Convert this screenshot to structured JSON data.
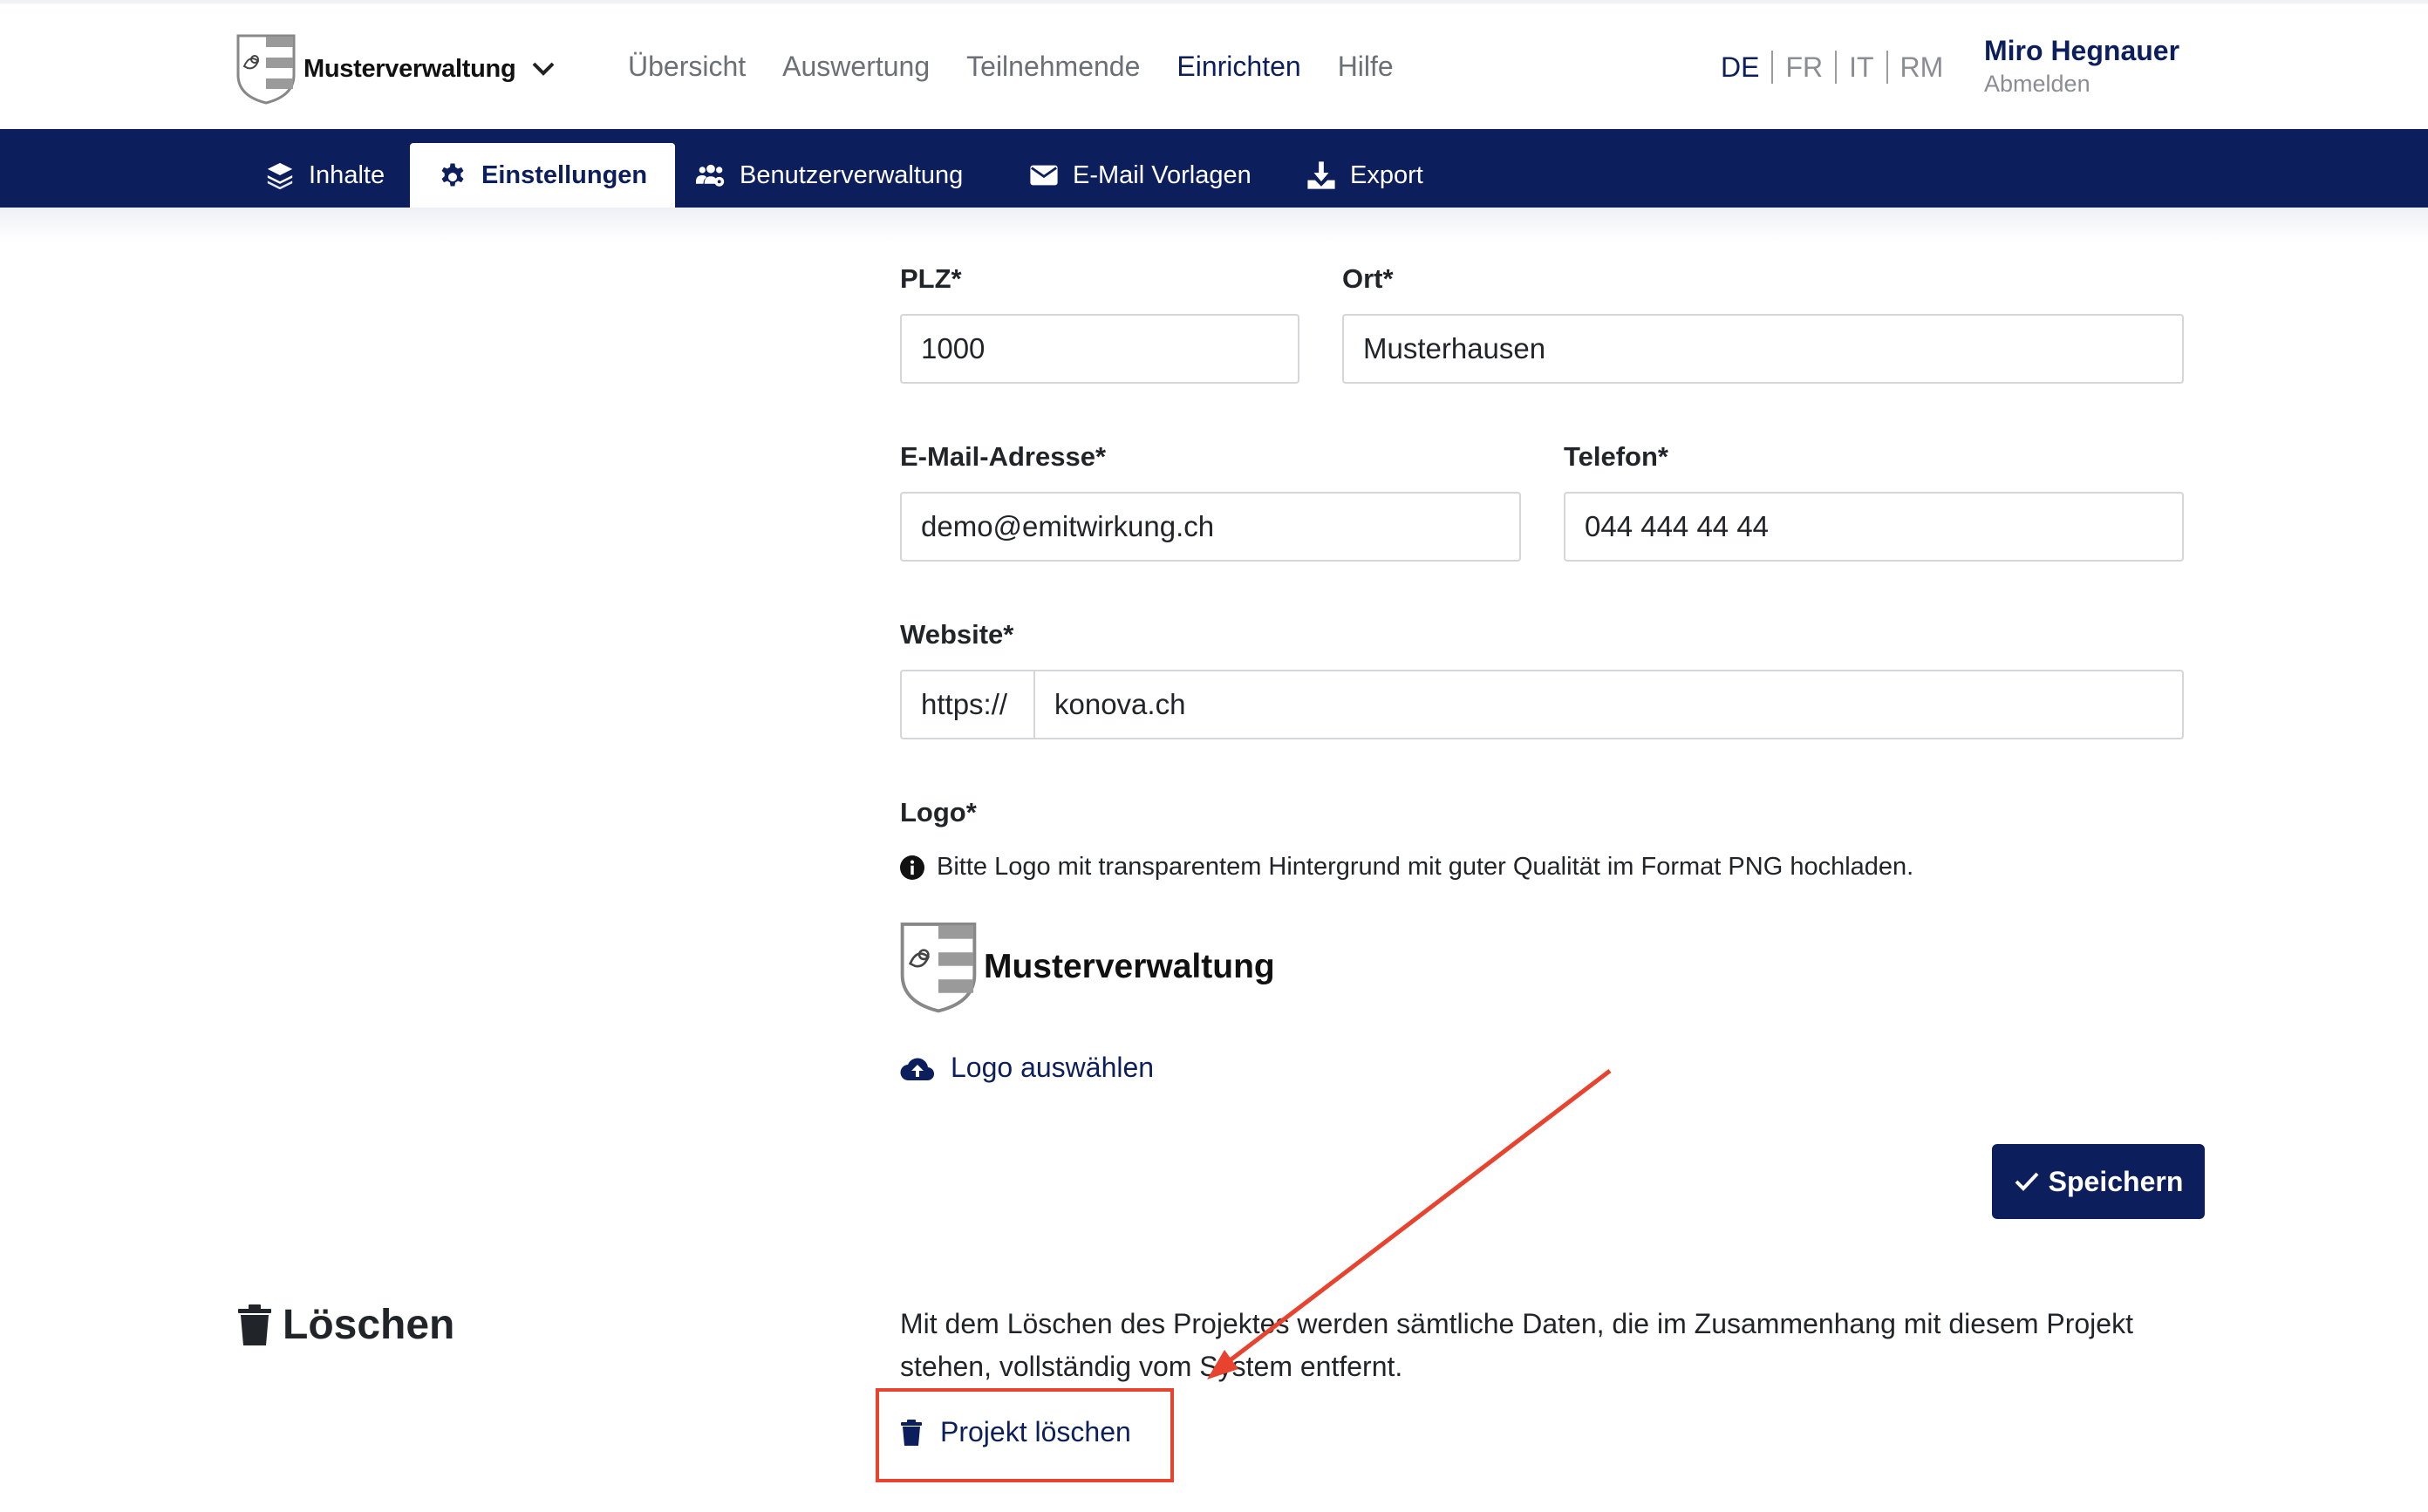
{
  "header": {
    "brand_name": "Musterverwaltung",
    "nav": [
      "Übersicht",
      "Auswertung",
      "Teilnehmende",
      "Einrichten",
      "Hilfe"
    ],
    "active_nav": "Einrichten",
    "languages": [
      "DE",
      "FR",
      "IT",
      "RM"
    ],
    "active_language": "DE",
    "user_name": "Miro Hegnauer",
    "logout_label": "Abmelden"
  },
  "subnav": {
    "tabs": [
      {
        "label": "Inhalte",
        "icon": "layers-icon"
      },
      {
        "label": "Einstellungen",
        "icon": "gear-icon"
      },
      {
        "label": "Benutzerverwaltung",
        "icon": "users-gear-icon"
      },
      {
        "label": "E-Mail Vorlagen",
        "icon": "envelope-icon"
      },
      {
        "label": "Export",
        "icon": "download-icon"
      }
    ],
    "active_tab": "Einstellungen"
  },
  "form": {
    "plz": {
      "label": "PLZ*",
      "value": "1000"
    },
    "ort": {
      "label": "Ort*",
      "value": "Musterhausen"
    },
    "email": {
      "label": "E-Mail-Adresse*",
      "value": "demo@emitwirkung.ch"
    },
    "telefon": {
      "label": "Telefon*",
      "value": "044 444 44 44"
    },
    "website": {
      "label": "Website*",
      "prefix": "https://",
      "value": "konova.ch"
    },
    "logo": {
      "label": "Logo*",
      "info": "Bitte Logo mit transparentem Hintergrund mit guter Qualität im Format PNG hochladen.",
      "preview_name": "Musterverwaltung",
      "upload_label": "Logo auswählen"
    },
    "save_label": "Speichern"
  },
  "delete_section": {
    "title": "Löschen",
    "text": "Mit dem Löschen des Projektes werden sämtliche Daten, die im Zusammenhang mit diesem Projekt stehen, vollständig vom System entfernt.",
    "button_label": "Projekt löschen"
  },
  "colors": {
    "primary": "#0c1f5c",
    "annotation": "#e8432e"
  }
}
